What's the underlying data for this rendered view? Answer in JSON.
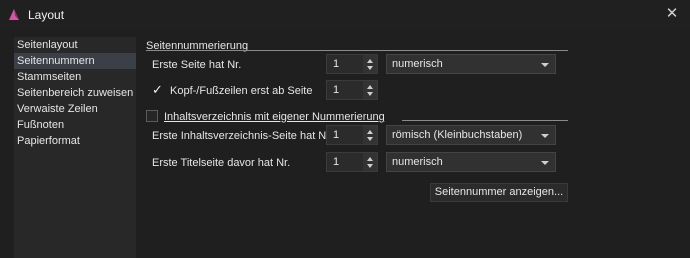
{
  "window": {
    "title": "Layout"
  },
  "sidebar": {
    "items": [
      {
        "label": "Seitenlayout"
      },
      {
        "label": "Seitennummern"
      },
      {
        "label": "Stammseiten"
      },
      {
        "label": "Seitenbereich zuweisen"
      },
      {
        "label": "Verwaiste Zeilen"
      },
      {
        "label": "Fußnoten"
      },
      {
        "label": "Papierformat"
      }
    ],
    "selected": "Seitennummern"
  },
  "main": {
    "section_title": "Seitennummerierung",
    "first_page": {
      "label": "Erste Seite hat Nr.",
      "value": "1",
      "format": "numerisch"
    },
    "header_footer": {
      "checked": true,
      "label": "Kopf-/Fußzeilen erst ab Seite",
      "value": "1"
    },
    "toc": {
      "checked": false,
      "label": "Inhaltsverzeichnis mit eigener Nummerierung",
      "first_page_label": "Erste Inhaltsverzeichnis-Seite hat Nr.",
      "first_page_value": "1",
      "format": "römisch (Kleinbuchstaben)"
    },
    "title_page": {
      "label": "Erste Titelseite davor hat Nr.",
      "value": "1",
      "format": "numerisch"
    },
    "show_button": "Seitennummer anzeigen..."
  }
}
